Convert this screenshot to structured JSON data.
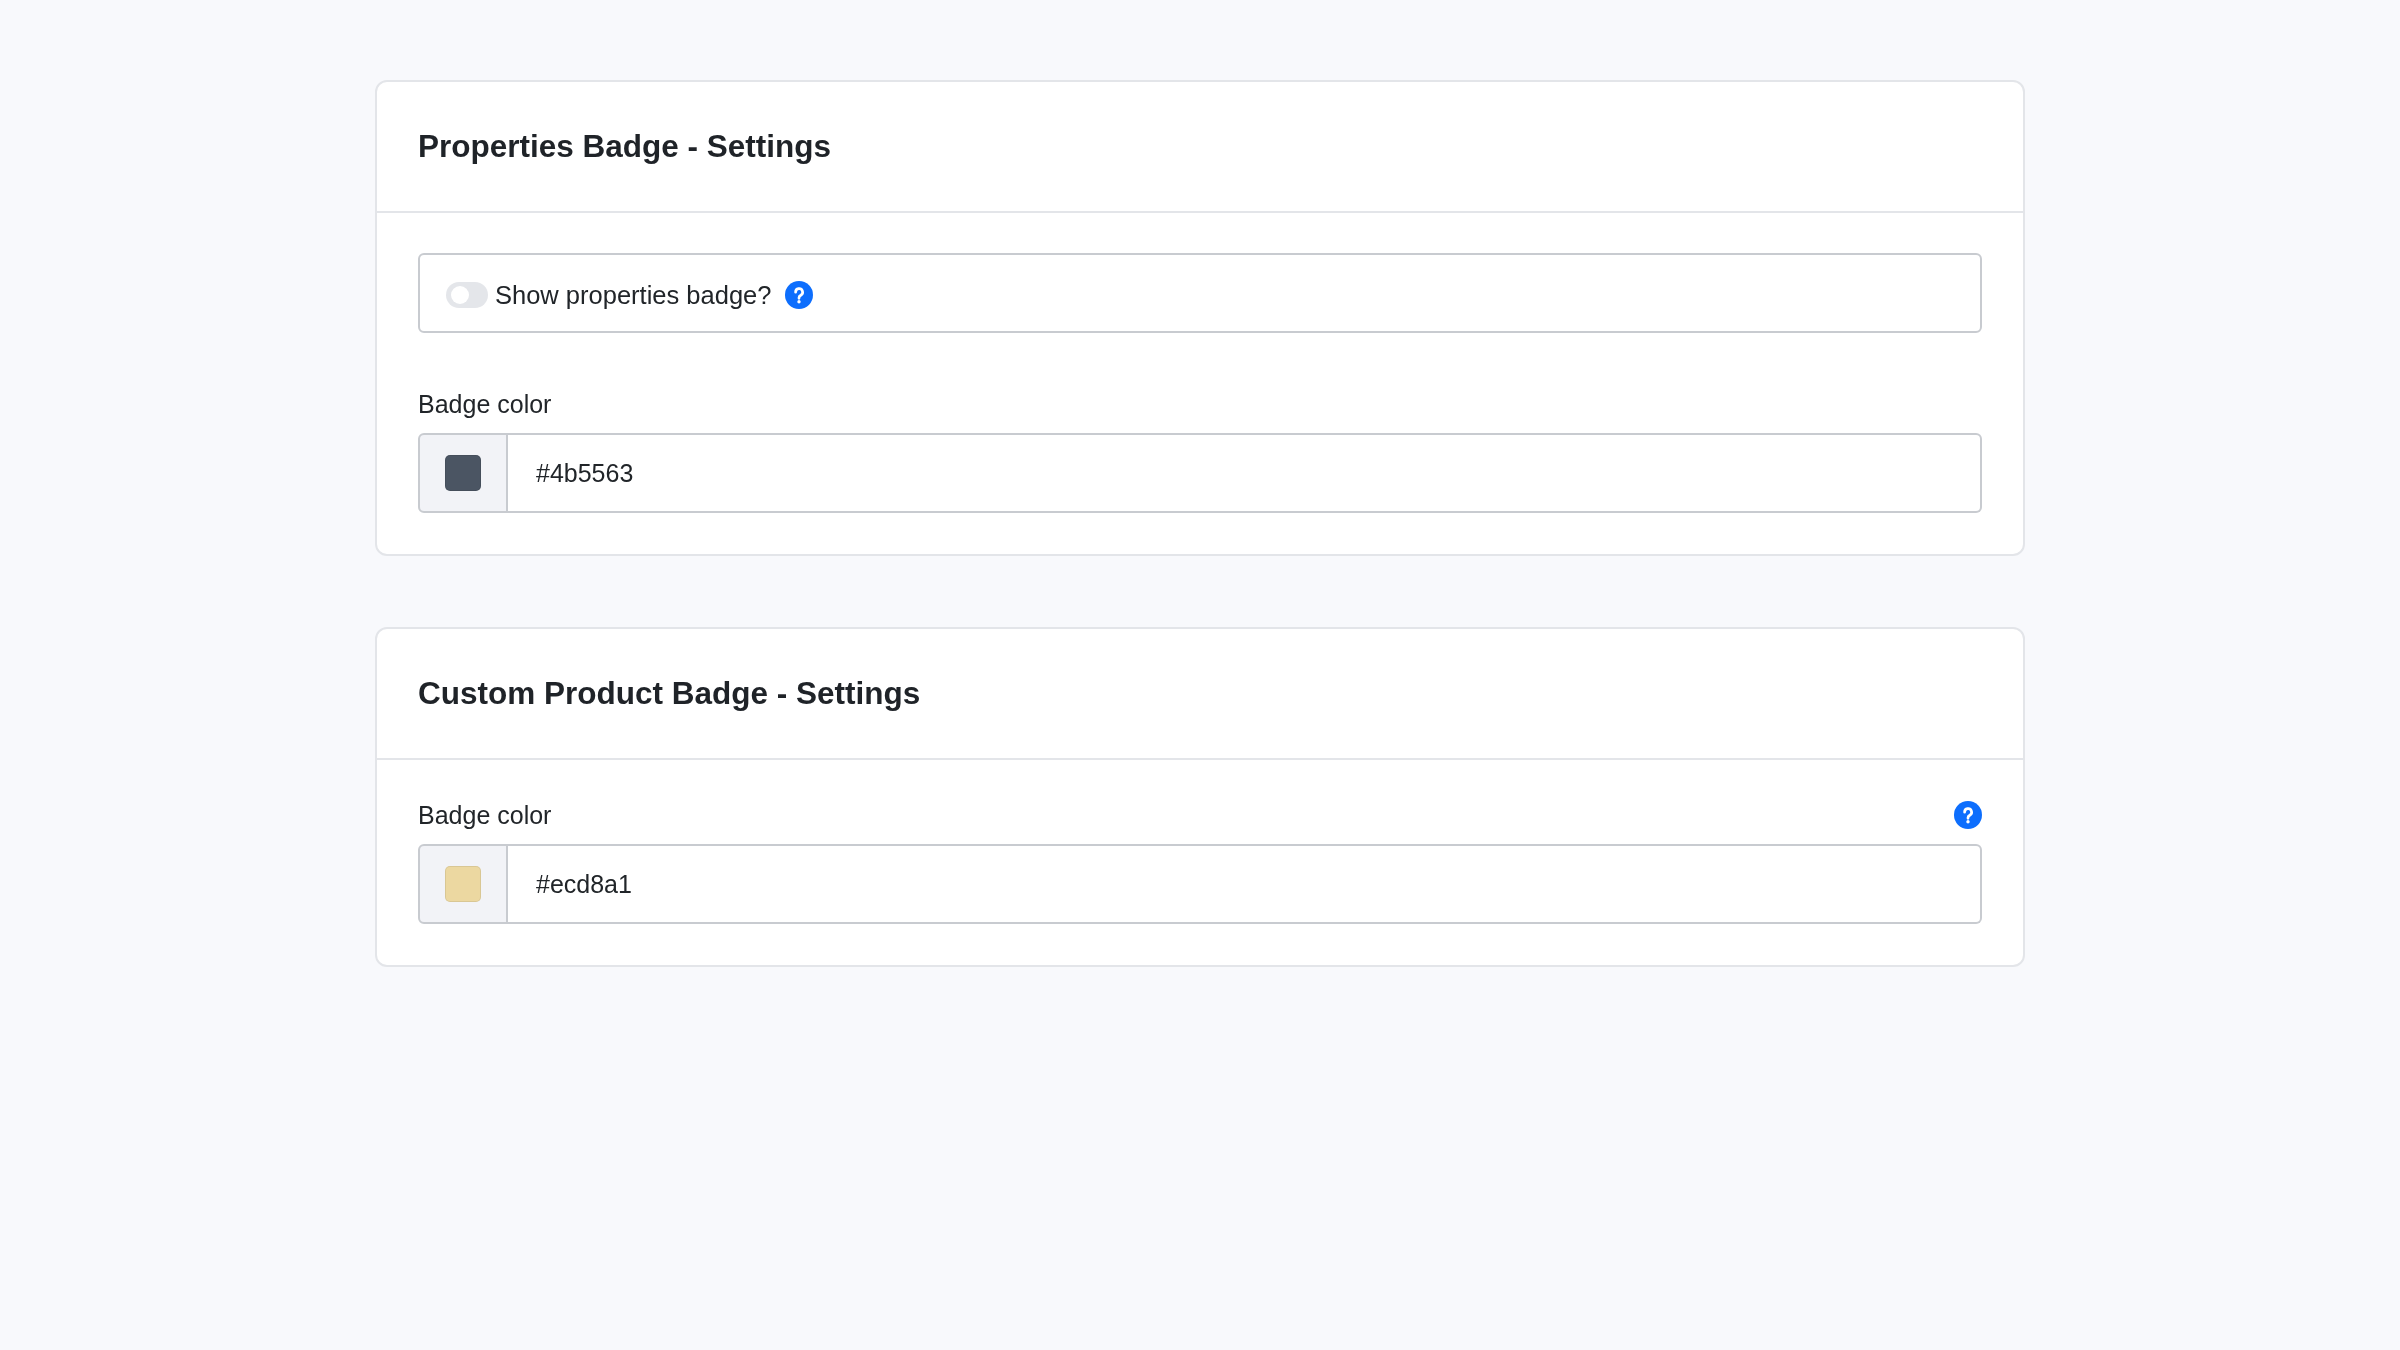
{
  "sections": [
    {
      "title": "Properties Badge - Settings",
      "fields": [
        {
          "kind": "toggle",
          "label": "Show properties badge?",
          "on": false,
          "help": true
        },
        {
          "kind": "color",
          "label": "Badge color",
          "value": "#4b5563",
          "color": "#4b5563"
        }
      ]
    },
    {
      "title": "Custom Product Badge - Settings",
      "fields": [
        {
          "kind": "color",
          "label": "Badge color",
          "value": "#ecd8a1",
          "color": "#ecd8a1",
          "help": true
        }
      ]
    }
  ]
}
